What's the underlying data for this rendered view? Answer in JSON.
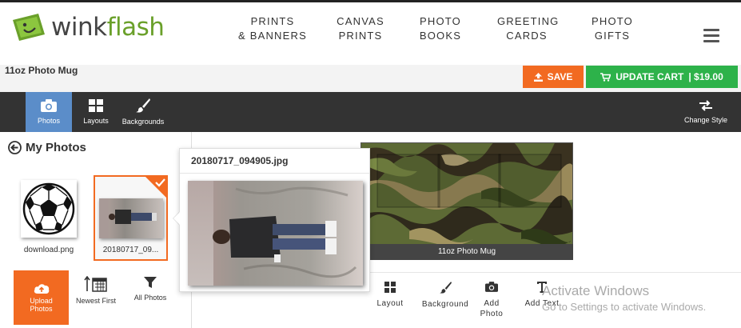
{
  "brand": {
    "name_part1": "wink",
    "name_part2": "flash",
    "accent_green": "#6aa02a",
    "accent_orange": "#f26a21",
    "cart_green": "#2db24a"
  },
  "nav": {
    "items": [
      {
        "line1": "PRINTS",
        "line2": "& BANNERS"
      },
      {
        "line1": "CANVAS",
        "line2": "PRINTS"
      },
      {
        "line1": "PHOTO",
        "line2": "BOOKS"
      },
      {
        "line1": "GREETING",
        "line2": "CARDS"
      },
      {
        "line1": "PHOTO",
        "line2": "GIFTS"
      }
    ],
    "menu_icon": "hamburger-icon"
  },
  "product": {
    "title": "11oz Photo Mug"
  },
  "actions": {
    "save_label": "SAVE",
    "cart_label": "UPDATE CART",
    "cart_price": "| $19.00"
  },
  "toolbar": {
    "tabs": [
      {
        "label": "Photos",
        "icon": "camera-icon",
        "active": true
      },
      {
        "label": "Layouts",
        "icon": "grid-icon",
        "active": false
      },
      {
        "label": "Backgrounds",
        "icon": "brush-icon",
        "active": false
      }
    ],
    "change_style": "Change Style"
  },
  "left_panel": {
    "heading": "My Photos",
    "photos": [
      {
        "label": "download.png",
        "selected": false
      },
      {
        "label": "20180717_09...",
        "selected": true
      }
    ],
    "tools": [
      {
        "label_line1": "Upload",
        "label_line2": "Photos"
      },
      {
        "label": "Newest First"
      },
      {
        "label": "All Photos"
      }
    ]
  },
  "popover": {
    "filename": "20180717_094905.jpg"
  },
  "canvas": {
    "label": "11oz Photo Mug"
  },
  "edit_tools": [
    {
      "label": "Layout",
      "icon": "grid-icon"
    },
    {
      "label": "Background",
      "icon": "brush-icon"
    },
    {
      "label_line1": "Add",
      "label_line2": "Photo",
      "icon": "camera-icon"
    },
    {
      "label": "Add Text",
      "icon": "text-icon"
    }
  ],
  "watermark": {
    "line1": "Activate Windows",
    "line2": "Go to Settings to activate Windows."
  }
}
